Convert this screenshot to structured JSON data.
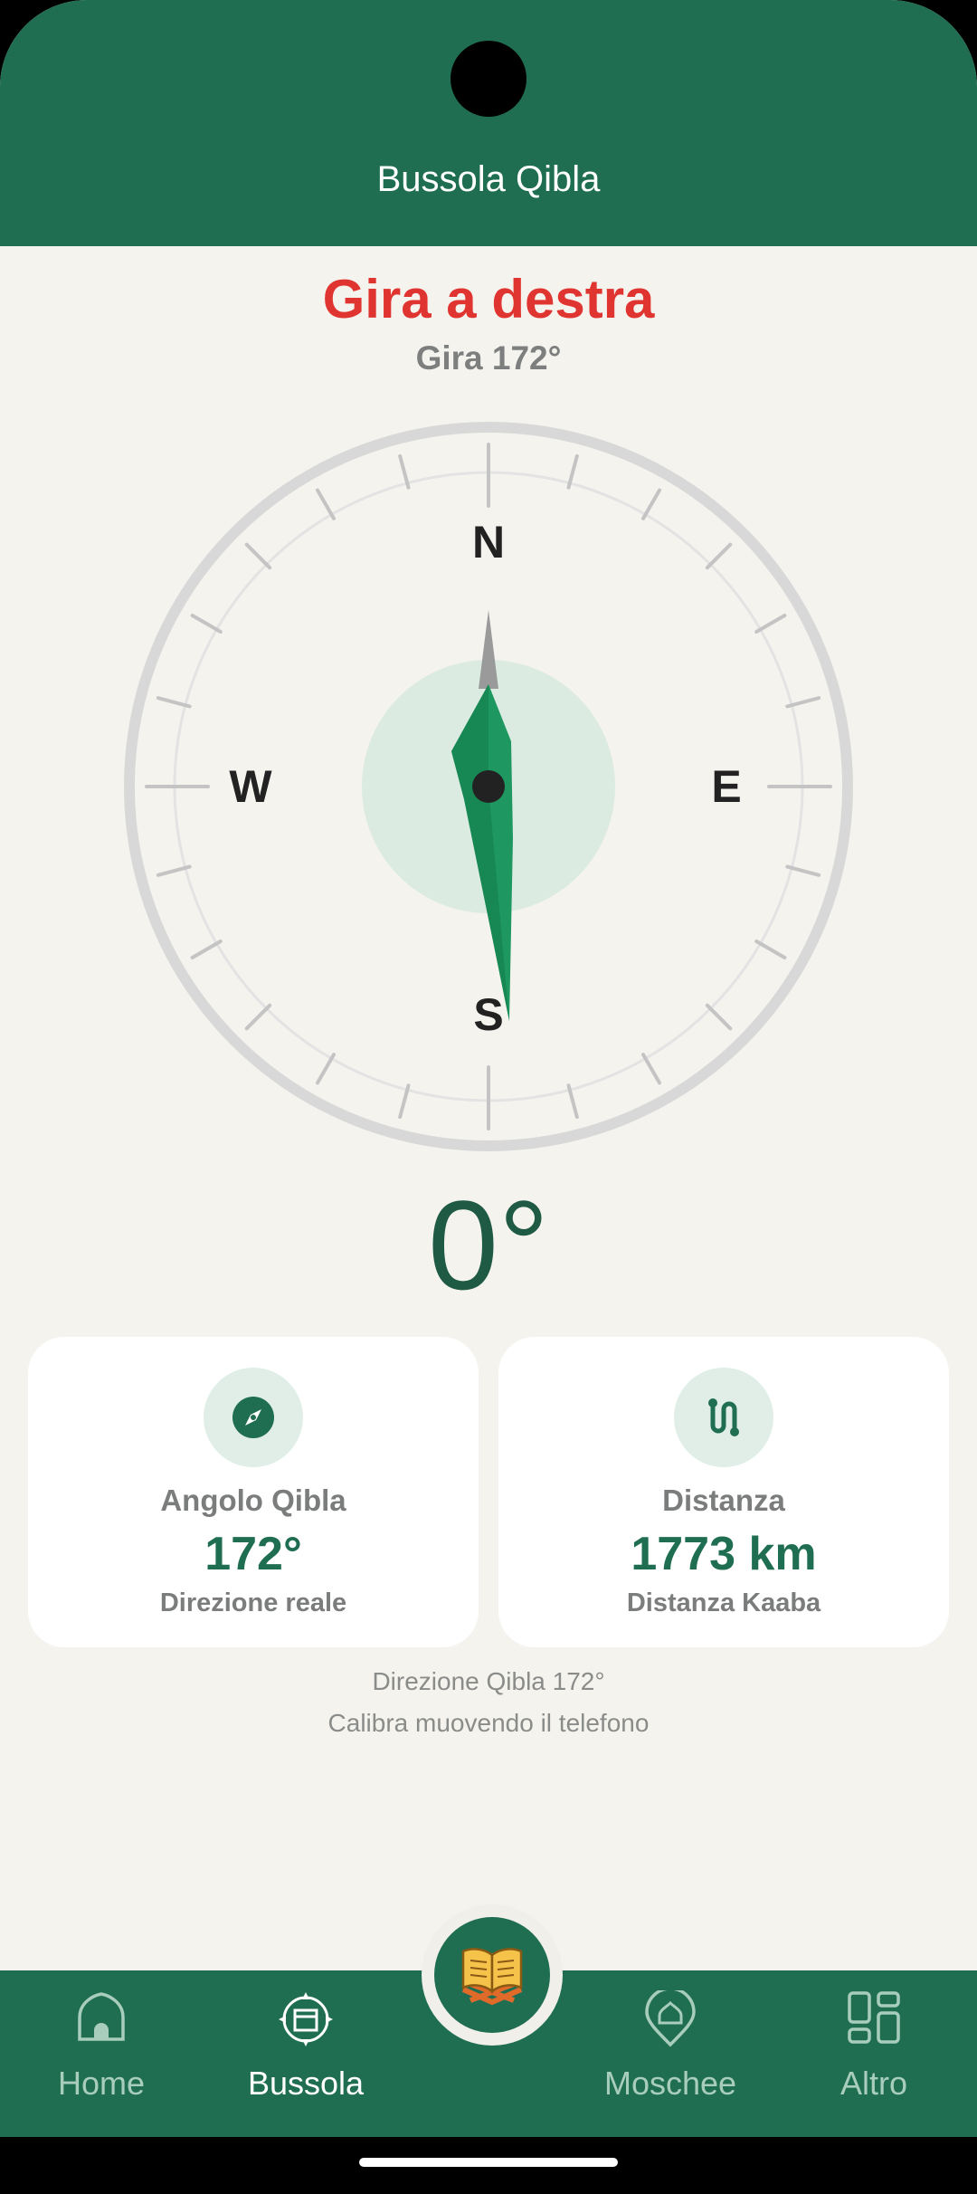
{
  "header": {
    "title": "Bussola Qibla"
  },
  "instruction": {
    "title": "Gira a destra",
    "subtitle": "Gira 172°"
  },
  "compass": {
    "cardinals": {
      "north": "N",
      "east": "E",
      "south": "S",
      "west": "W"
    },
    "needle_angle_deg": 172,
    "heading_text": "0°"
  },
  "cards": {
    "qibla_angle": {
      "icon": "compass-icon",
      "label": "Angolo Qibla",
      "value": "172°",
      "caption": "Direzione reale"
    },
    "distance": {
      "icon": "route-icon",
      "label": "Distanza",
      "value": "1773 km",
      "caption": "Distanza Kaaba"
    }
  },
  "info": {
    "line1": "Direzione Qibla 172°",
    "line2": "Calibra muovendo il telefono"
  },
  "nav": {
    "items": [
      {
        "label": "Home",
        "icon": "home-mosque-icon",
        "active": false
      },
      {
        "label": "Bussola",
        "icon": "kaaba-compass-icon",
        "active": true
      },
      {
        "label": "Moschee",
        "icon": "mosque-pin-icon",
        "active": false
      },
      {
        "label": "Altro",
        "icon": "grid-icon",
        "active": false
      }
    ],
    "center_button": {
      "icon": "quran-book-icon"
    }
  },
  "colors": {
    "primary": "#1f6e52",
    "accent_red": "#e03431",
    "background": "#f5f3ee",
    "needle": "#1e9860"
  }
}
